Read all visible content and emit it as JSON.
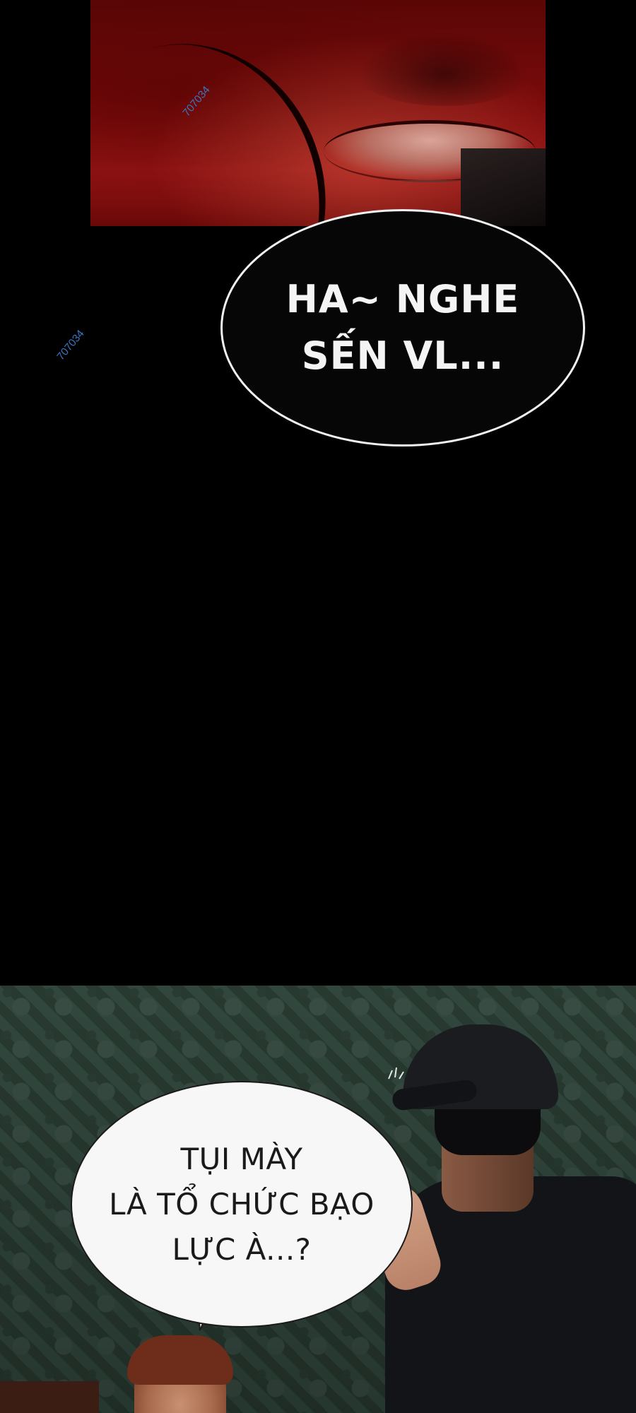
{
  "top_bubble": {
    "lines": [
      "HA~ NGHE",
      "SẾN VL..."
    ]
  },
  "bottom_bubble": {
    "lines": [
      "TỤI MÀY",
      "LÀ TỔ CHỨC BẠO",
      "LỰC À...?"
    ]
  },
  "watermarks": [
    "707034",
    "707034"
  ],
  "colors": {
    "background": "#000000",
    "top_panel_red": "#951414",
    "wallpaper_green": "#314a3f",
    "bubble_dark_fill": "#060606",
    "bubble_white_fill": "#f7f7f7",
    "watermark_blue": "#3a76c2"
  }
}
